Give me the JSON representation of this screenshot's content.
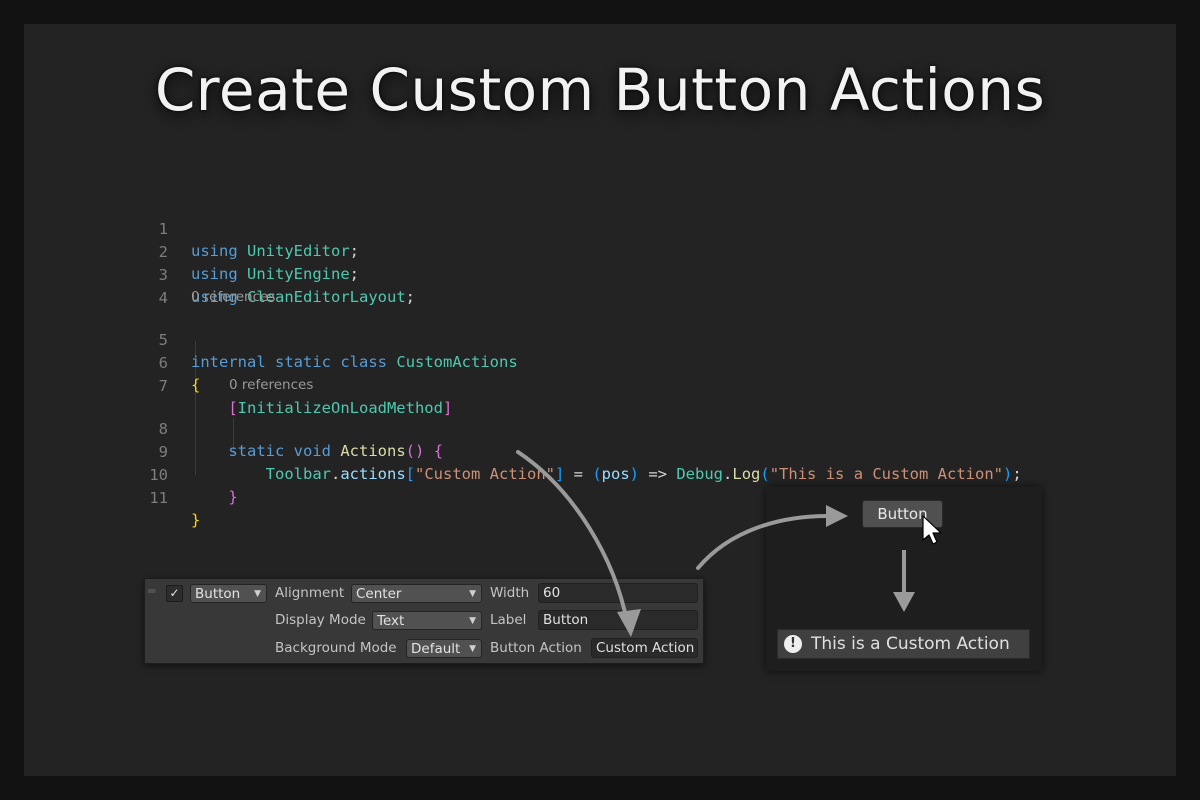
{
  "title": "Create Custom Button Actions",
  "code": {
    "line_numbers": [
      "1",
      "2",
      "3",
      "4",
      "5",
      "6",
      "7",
      "8",
      "9",
      "10",
      "11"
    ],
    "lens_references_1": "0 references",
    "lens_references_2": "0 references",
    "l1": {
      "kw": "using",
      "ns": "UnityEditor",
      "semi": ";"
    },
    "l2": {
      "kw": "using",
      "ns": "UnityEngine",
      "semi": ";"
    },
    "l3": {
      "kw": "using",
      "ns": "CleanEditorLayout",
      "semi": ";"
    },
    "l5": {
      "kw1": "internal",
      "kw2": "static",
      "kw3": "class",
      "name": "CustomActions"
    },
    "l6": {
      "brace": "{"
    },
    "l7": {
      "open": "[",
      "attr": "InitializeOnLoadMethod",
      "close": "]"
    },
    "l8": {
      "kw1": "static",
      "kw2": "void",
      "fn": "Actions",
      "parens": "()",
      "brace": "{"
    },
    "l9": {
      "type": "Toolbar",
      "dot1": ".",
      "member": "actions",
      "ob": "[",
      "str1": "\"Custom Action\"",
      "cb": "]",
      "eq": " = ",
      "op": "(",
      "param": "pos",
      "cp": ")",
      "arrow": " => ",
      "type2": "Debug",
      "dot2": ".",
      "fn": "Log",
      "op2": "(",
      "str2": "\"This is a Custom Action\"",
      "cp2": ")",
      "semi": ";"
    },
    "l10": {
      "brace": "}"
    },
    "l11": {
      "brace": "}"
    }
  },
  "inspector": {
    "checked": "✓",
    "handle": "═",
    "type_value": "Button",
    "alignment_label": "Alignment",
    "alignment_value": "Center",
    "width_label": "Width",
    "width_value": "60",
    "display_mode_label": "Display Mode",
    "display_mode_value": "Text",
    "label_label": "Label",
    "label_value": "Button",
    "background_mode_label": "Background Mode",
    "background_mode_value": "Default",
    "button_action_label": "Button Action",
    "button_action_value": "Custom Action"
  },
  "preview": {
    "button_label": "Button",
    "info_glyph": "!",
    "console_message": "This is a Custom Action"
  },
  "colors": {
    "keyword": "#569cd6",
    "type": "#4ec9b0",
    "string": "#ce9178",
    "method": "#dcdcaa",
    "parameter": "#9cdcfe",
    "bracket_gold": "#ffd700",
    "bracket_purple": "#da70d6",
    "bracket_blue": "#179fff"
  }
}
